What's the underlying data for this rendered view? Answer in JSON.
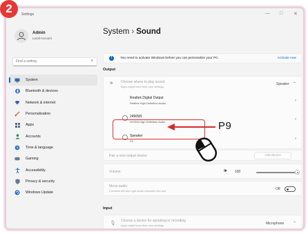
{
  "annotation": {
    "step_number": "2",
    "callout_label": "P9",
    "accent_color": "#e53935"
  },
  "window": {
    "title": "Settings",
    "controls": {
      "minimize": "—",
      "maximize": "□",
      "close": "✕"
    }
  },
  "account": {
    "name": "Admin",
    "subtitle": "Local Account"
  },
  "search": {
    "placeholder": "Find a setting",
    "icon": "search-icon"
  },
  "sidebar": {
    "items": [
      {
        "label": "System",
        "icon": "monitor-icon",
        "active": true
      },
      {
        "label": "Bluetooth & devices",
        "icon": "bluetooth-icon"
      },
      {
        "label": "Network & internet",
        "icon": "wifi-icon"
      },
      {
        "label": "Personalization",
        "icon": "brush-icon"
      },
      {
        "label": "Apps",
        "icon": "apps-icon"
      },
      {
        "label": "Accounts",
        "icon": "person-icon"
      },
      {
        "label": "Time & language",
        "icon": "globe-clock-icon"
      },
      {
        "label": "Gaming",
        "icon": "gamepad-icon"
      },
      {
        "label": "Accessibility",
        "icon": "accessibility-icon"
      },
      {
        "label": "Privacy & security",
        "icon": "shield-icon"
      },
      {
        "label": "Windows Update",
        "icon": "update-icon"
      }
    ]
  },
  "main": {
    "breadcrumb_parent": "System",
    "breadcrumb_separator": "›",
    "breadcrumb_current": "Sound",
    "banner": {
      "message": "You need to activate Windows before you can personalize your PC.",
      "action": "Activate now"
    },
    "output_heading": "Output",
    "play_sound": {
      "title": "Choose where to play sound",
      "subtitle": "Apps might have their own settings",
      "value": "Speaker"
    },
    "devices": [
      {
        "name": "Realtek Digital Output",
        "desc": "Realtek High Definition Audio"
      },
      {
        "name": "2490WI",
        "desc": "NVIDIA High Definition Audio"
      },
      {
        "name": "Speaker",
        "desc": "P9"
      }
    ],
    "pair": {
      "label": "Pair a new output device",
      "button": "Add device"
    },
    "volume": {
      "label": "Volume",
      "value": "100",
      "level_percent": 100
    },
    "mono": {
      "title": "Mono audio",
      "subtitle": "Combine left and right audio channels into one",
      "state": "Off"
    },
    "input_heading": "Input",
    "input_choose": {
      "title": "Choose a device for speaking or recording",
      "subtitle": "Apps might have their own settings",
      "value": "Microphone"
    }
  }
}
